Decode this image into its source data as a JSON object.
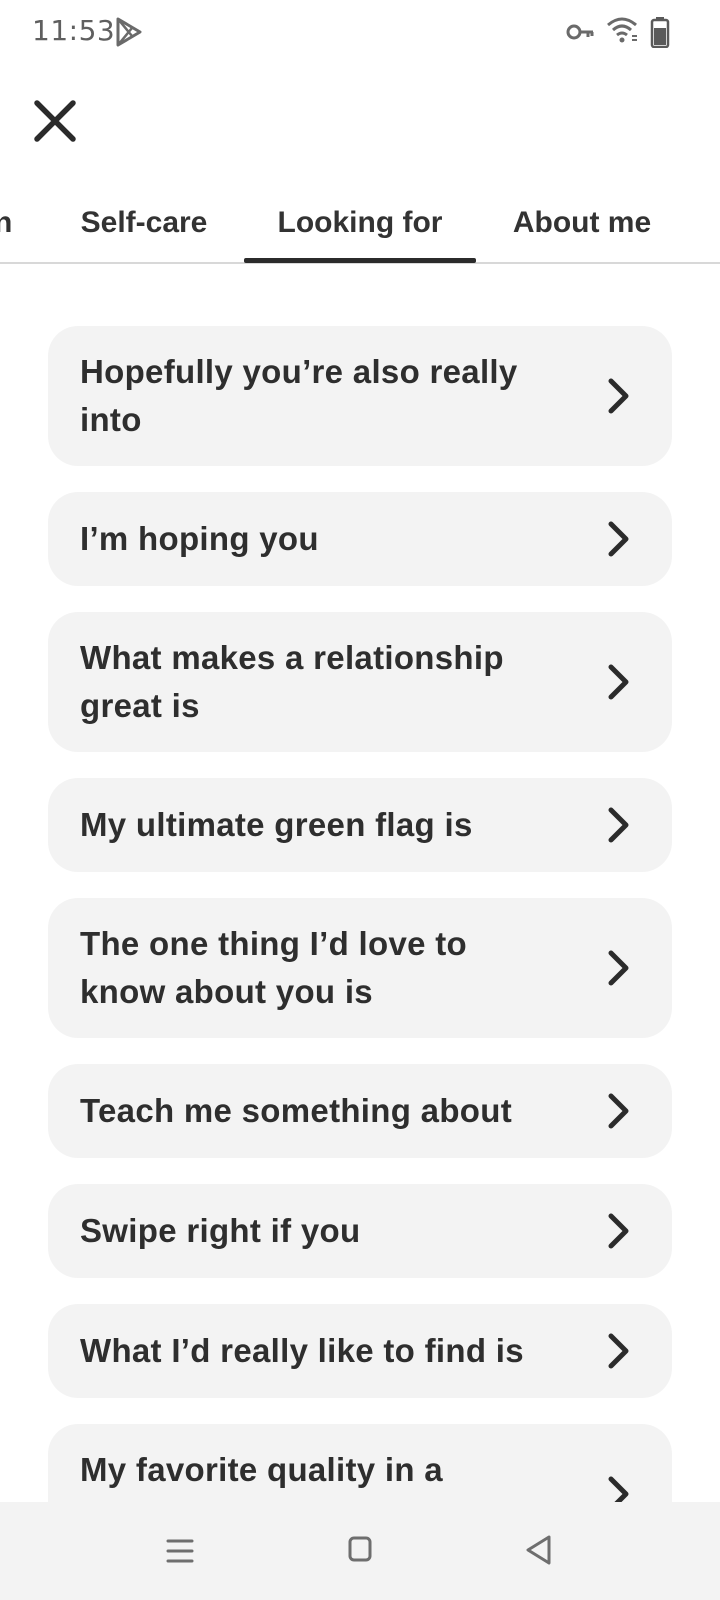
{
  "status_bar": {
    "time": "11:53",
    "icons": [
      "play-store-icon",
      "vpn-key-icon",
      "wifi-icon",
      "battery-icon"
    ]
  },
  "header": {
    "close_icon": "close-icon"
  },
  "tabs": [
    {
      "label": "n",
      "selected": false
    },
    {
      "label": "Self-care",
      "selected": false
    },
    {
      "label": "Looking for",
      "selected": true
    },
    {
      "label": "About me",
      "selected": false
    }
  ],
  "prompts": [
    {
      "label": "Hopefully you’re also really into"
    },
    {
      "label": "I’m hoping you"
    },
    {
      "label": "What makes a relationship great is"
    },
    {
      "label": "My ultimate green flag is"
    },
    {
      "label": "The one thing I’d love to know about you is"
    },
    {
      "label": "Teach me something about"
    },
    {
      "label": "Swipe right if you"
    },
    {
      "label": "What I’d really like to find is"
    },
    {
      "label": "My favorite quality in a person is"
    }
  ],
  "nav_bar": {
    "icons": [
      "recent-apps-icon",
      "home-icon",
      "back-icon"
    ]
  },
  "colors": {
    "card_background": "#f3f3f3",
    "text": "#2e2e2e",
    "tab_indicator": "#2b2b2b"
  }
}
